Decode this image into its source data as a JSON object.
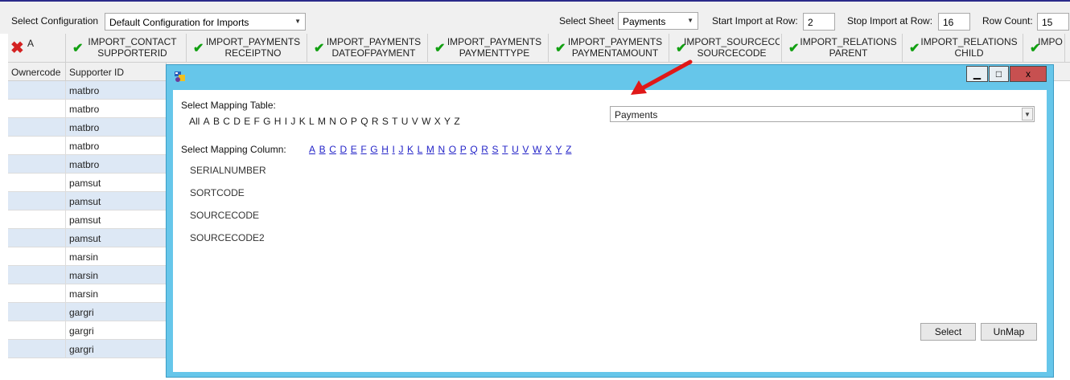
{
  "toolbar": {
    "select_configuration_label": "Select Configuration",
    "configuration_value": "Default Configuration for Imports",
    "select_sheet_label": "Select Sheet",
    "sheet_value": "Payments",
    "start_row_label": "Start Import at Row:",
    "start_row_value": "2",
    "stop_row_label": "Stop Import at Row:",
    "stop_row_value": "16",
    "row_count_label": "Row Count:",
    "row_count_value": "15"
  },
  "grid": {
    "first_col_header": "A",
    "columns": [
      {
        "line1": "IMPORT_CONTACT",
        "line2": "SUPPORTERID"
      },
      {
        "line1": "IMPORT_PAYMENTS",
        "line2": "RECEIPTNO"
      },
      {
        "line1": "IMPORT_PAYMENTS",
        "line2": "DATEOFPAYMENT"
      },
      {
        "line1": "IMPORT_PAYMENTS",
        "line2": "PAYMENTTYPE"
      },
      {
        "line1": "IMPORT_PAYMENTS",
        "line2": "PAYMENTAMOUNT"
      },
      {
        "line1": "IMPORT_SOURCECC",
        "line2": "SOURCECODE"
      },
      {
        "line1": "IMPORT_RELATIONS",
        "line2": "PARENT"
      },
      {
        "line1": "IMPORT_RELATIONS",
        "line2": "CHILD"
      },
      {
        "line1": "IMPO",
        "line2": ""
      }
    ],
    "sub_headers": [
      "Ownercode",
      "Supporter ID"
    ],
    "rows": [
      "matbro",
      "matbro",
      "matbro",
      "matbro",
      "matbro",
      "pamsut",
      "pamsut",
      "pamsut",
      "pamsut",
      "marsin",
      "marsin",
      "marsin",
      "gargri",
      "gargri",
      "gargri"
    ]
  },
  "dialog": {
    "minimize": "▁",
    "maximize": "□",
    "close": "x",
    "select_table_label": "Select Mapping Table:",
    "table_letters": [
      "All",
      "A",
      "B",
      "C",
      "D",
      "E",
      "F",
      "G",
      "H",
      "I",
      "J",
      "K",
      "L",
      "M",
      "N",
      "O",
      "P",
      "Q",
      "R",
      "S",
      "T",
      "U",
      "V",
      "W",
      "X",
      "Y",
      "Z"
    ],
    "table_value": "Payments",
    "select_column_label": "Select Mapping Column:",
    "column_letters": [
      "A",
      "B",
      "C",
      "D",
      "E",
      "F",
      "G",
      "H",
      "I",
      "J",
      "K",
      "L",
      "M",
      "N",
      "O",
      "P",
      "Q",
      "R",
      "S",
      "T",
      "U",
      "V",
      "W",
      "X",
      "Y",
      "Z"
    ],
    "columns": [
      "SERIALNUMBER",
      "SORTCODE",
      "SOURCECODE",
      "SOURCECODE2"
    ],
    "select_button": "Select",
    "unmap_button": "UnMap"
  },
  "colors": {
    "dialog_frame": "#66c6ea",
    "check": "#12a012",
    "error_x": "#d42222",
    "arrow": "#e01818",
    "link": "#2424c8",
    "alt_row": "#dde8f5"
  },
  "icons": [
    "checkmark-icon",
    "red-x-icon",
    "app-icon",
    "dropdown-arrow-icon",
    "red-arrow-annotation"
  ]
}
